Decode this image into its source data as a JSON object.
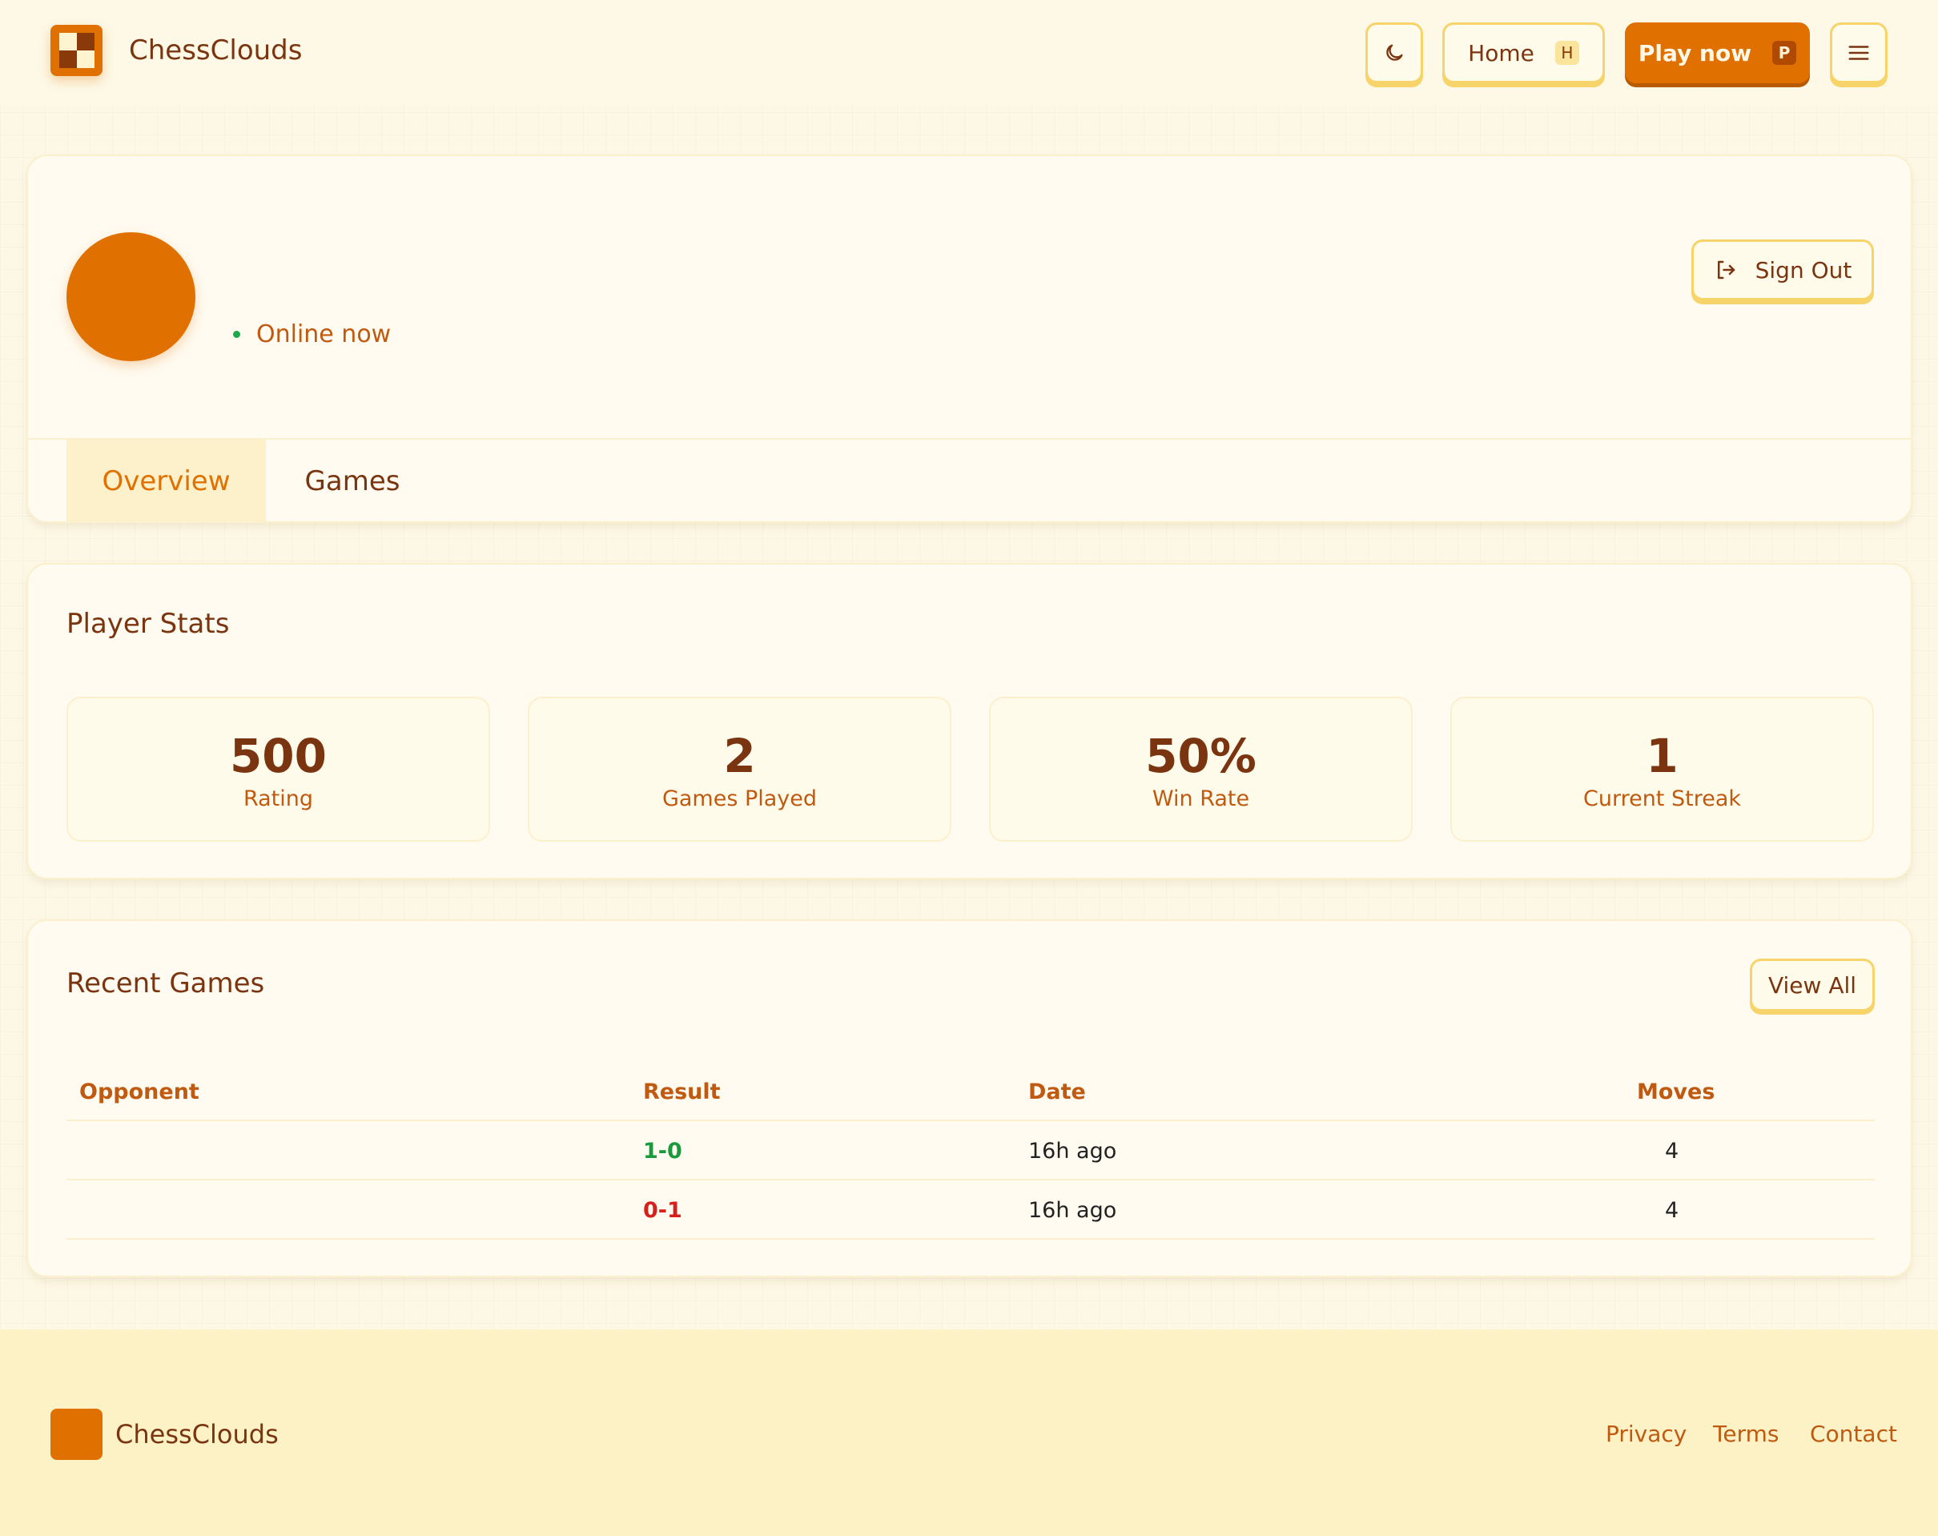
{
  "header": {
    "brand": "ChessClouds",
    "theme_icon": "moon-icon",
    "home_label": "Home",
    "home_key": "H",
    "play_label": "Play now",
    "play_key": "P",
    "menu_icon": "hamburger-menu-icon"
  },
  "profile": {
    "status": "Online now",
    "signout_label": "Sign Out",
    "tabs": [
      {
        "label": "Overview",
        "active": true
      },
      {
        "label": "Games",
        "active": false
      }
    ]
  },
  "stats": {
    "title": "Player Stats",
    "items": [
      {
        "value": "500",
        "label": "Rating"
      },
      {
        "value": "2",
        "label": "Games Played"
      },
      {
        "value": "50%",
        "label": "Win Rate"
      },
      {
        "value": "1",
        "label": "Current Streak"
      }
    ]
  },
  "recent_games": {
    "title": "Recent Games",
    "view_all_label": "View All",
    "columns": [
      "Opponent",
      "Result",
      "Date",
      "Moves"
    ],
    "rows": [
      {
        "opponent": "",
        "result": "1-0",
        "date": "16h ago",
        "moves": "4"
      },
      {
        "opponent": "",
        "result": "0-1",
        "date": "16h ago",
        "moves": "4"
      }
    ]
  },
  "footer": {
    "brand": "ChessClouds",
    "links": [
      "Privacy",
      "Terms",
      "Contact"
    ]
  },
  "colors": {
    "accent": "#e07100",
    "text": "#7a3510",
    "border": "#f7d46a",
    "win": "#1a9a3c",
    "loss": "#d6201c",
    "online": "#1fa84a"
  }
}
